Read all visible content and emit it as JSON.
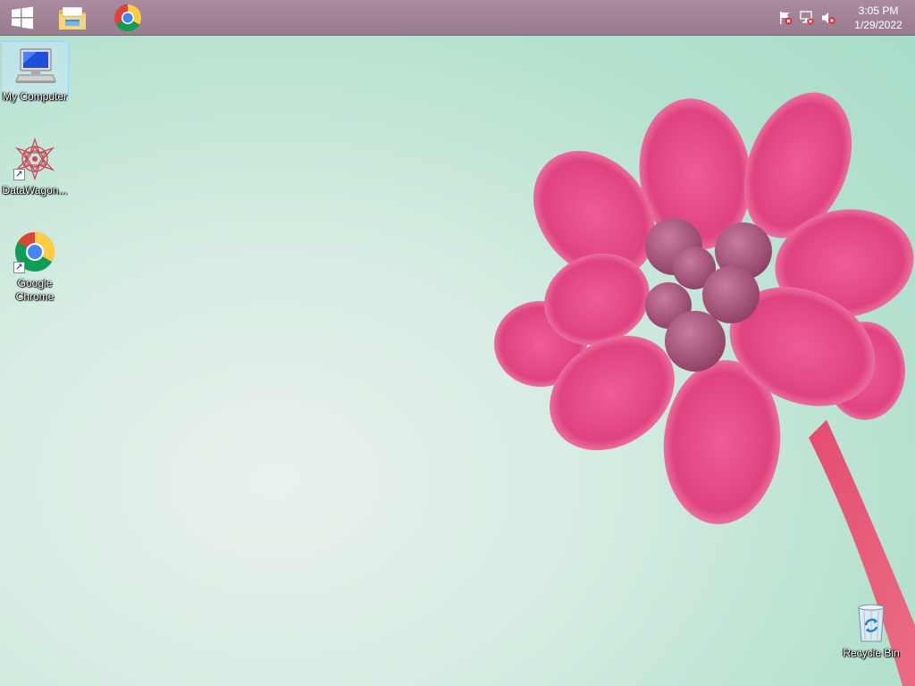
{
  "taskbar": {
    "start_icon": "windows-logo-icon",
    "pinned": [
      {
        "name": "file-explorer",
        "icon": "folder-icon"
      },
      {
        "name": "google-chrome",
        "icon": "chrome-icon"
      }
    ],
    "tray_icons": [
      "action-center-flag-icon",
      "network-icon",
      "volume-muted-icon"
    ],
    "clock": {
      "time": "3:05 PM",
      "date": "1/29/2022"
    }
  },
  "desktop": {
    "icons": [
      {
        "label": "My Computer",
        "icon": "computer-icon",
        "selected": true
      },
      {
        "label": "DataWagon...",
        "icon": "datawagon-icon",
        "selected": false
      },
      {
        "label": "Google Chrome",
        "icon": "chrome-icon",
        "selected": false
      },
      {
        "label": "Recycle Bin",
        "icon": "recycle-bin-icon",
        "selected": false
      }
    ]
  },
  "colors": {
    "taskbar": "#9a7c90",
    "flower": "#e0437f",
    "background": "#b5e1cf"
  }
}
